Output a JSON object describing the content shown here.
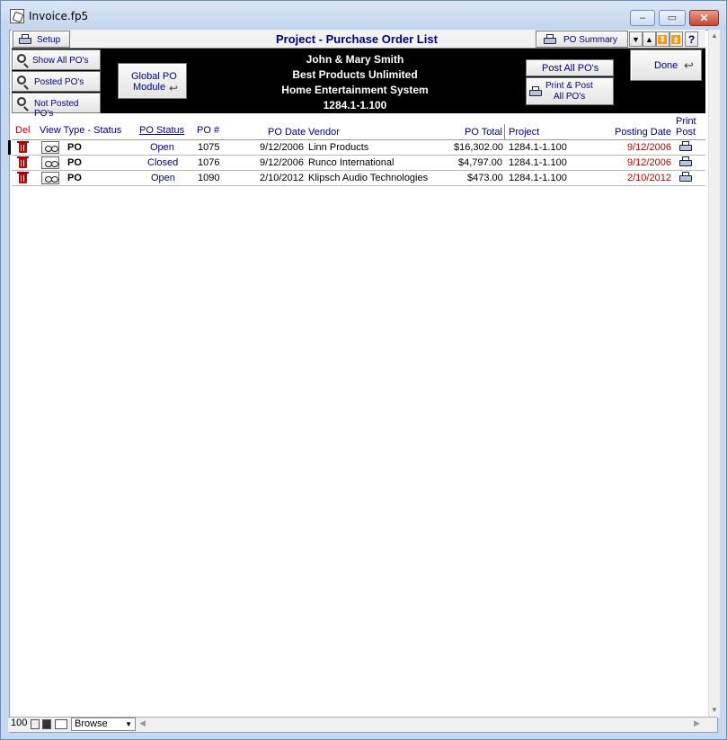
{
  "window": {
    "title": "Invoice.fp5",
    "min": "–",
    "max": "▭",
    "close": "✕"
  },
  "toolbar": {
    "setup_label": "Setup",
    "page_title": "Project - Purchase Order List",
    "po_summary_label": "PO Summary",
    "nav": [
      "▼",
      "▲",
      "⏬",
      "⏫"
    ],
    "help": "?"
  },
  "left_buttons": [
    "Show All PO's",
    "Posted PO's",
    "Not Posted PO's"
  ],
  "global_po": {
    "line1": "Global  PO",
    "line2": "Module"
  },
  "client": {
    "name": "John & Mary Smith",
    "company": "Best Products Unlimited",
    "system": "Home Entertainment System",
    "project": "1284.1-1.100"
  },
  "post_all_label": "Post All PO's",
  "print_post_label": {
    "line1": "Print & Post",
    "line2": "All PO's"
  },
  "done_label": "Done",
  "columns": {
    "del": "Del",
    "view_type_status": "View Type - Status",
    "po_status": "PO Status",
    "po_num": "PO #",
    "po_date": "PO Date",
    "vendor": "Vendor",
    "po_total": "PO Total",
    "project": "Project",
    "posting_date": "Posting Date",
    "print_post_1": "Print",
    "print_post_2": "Post"
  },
  "rows": [
    {
      "type": "PO",
      "status": "Open",
      "po_num": "1075",
      "po_date": "9/12/2006",
      "vendor": "Linn Products",
      "total": "$16,302.00",
      "project": "1284.1-1.100",
      "posting_date": "9/12/2006"
    },
    {
      "type": "PO",
      "status": "Closed",
      "po_num": "1076",
      "po_date": "9/12/2006",
      "vendor": "Runco International",
      "total": "$4,797.00",
      "project": "1284.1-1.100",
      "posting_date": "9/12/2006"
    },
    {
      "type": "PO",
      "status": "Open",
      "po_num": "1090",
      "po_date": "2/10/2012",
      "vendor": "Klipsch Audio Technologies",
      "total": "$473.00",
      "project": "1284.1-1.100",
      "posting_date": "2/10/2012"
    }
  ],
  "statusbar": {
    "zoom": "100",
    "mode": "Browse"
  },
  "colors": {
    "accent": "#000080",
    "posting": "#c00000",
    "band": "#000000"
  }
}
